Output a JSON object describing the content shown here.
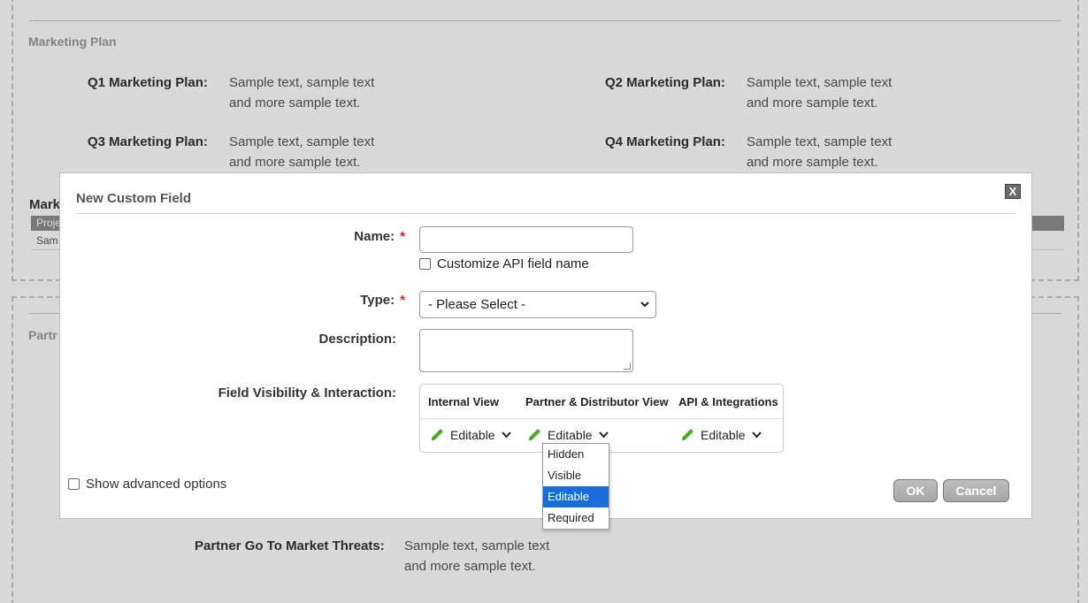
{
  "background": {
    "section_title": "Marketing Plan",
    "plans": [
      {
        "label": "Q1 Marketing Plan:",
        "line1": "Sample text, sample text",
        "line2": "and more sample text."
      },
      {
        "label": "Q2 Marketing Plan:",
        "line1": "Sample text, sample text",
        "line2": "and more sample text."
      },
      {
        "label": "Q3 Marketing Plan:",
        "line1": "Sample text, sample text",
        "line2": "and more sample text."
      },
      {
        "label": "Q4 Marketing Plan:",
        "line1": "Sample text, sample text",
        "line2": "and more sample text."
      }
    ],
    "mark_partial": "Mark",
    "table_header_partial": "Proje",
    "table_cell_partial": "Sam",
    "partner_partial": "Partr",
    "threats": {
      "label": "Partner Go To Market Threats:",
      "line1": "Sample text, sample text",
      "line2": "and more sample text."
    }
  },
  "dialog": {
    "title": "New Custom Field",
    "close_label": "X",
    "name_label": "Name:",
    "required_mark": "*",
    "customize_api_label": "Customize API field name",
    "type_label": "Type:",
    "type_value": "- Please Select -",
    "description_label": "Description:",
    "visibility_label": "Field Visibility & Interaction:",
    "visibility": {
      "headers": [
        "Internal View",
        "Partner & Distributor View",
        "API & Integrations"
      ],
      "values": [
        "Editable",
        "Editable",
        "Editable"
      ]
    },
    "dropdown_options": [
      "Hidden",
      "Visible",
      "Editable",
      "Required"
    ],
    "dropdown_selected": "Editable",
    "advanced_label": "Show advanced options",
    "ok_label": "OK",
    "cancel_label": "Cancel"
  },
  "colors": {
    "pencil": "#4caf2a",
    "selected": "#1a6dd8",
    "required": "#d62020"
  }
}
